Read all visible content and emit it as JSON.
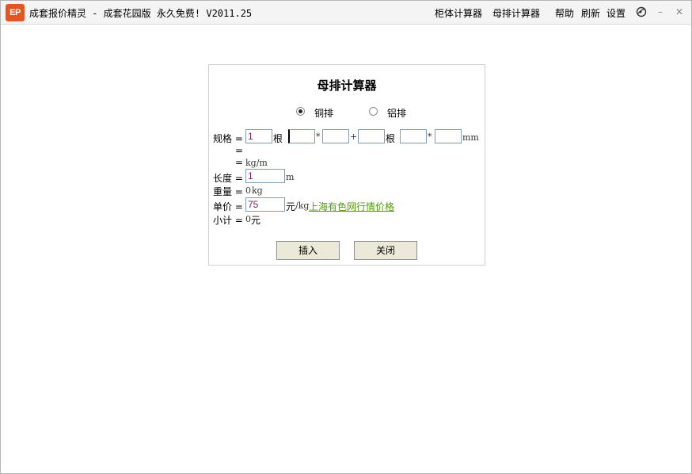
{
  "app": {
    "logo_text": "EP",
    "title": "成套报价精灵 - 成套花园版 永久免费! V2011.25"
  },
  "menu": {
    "cabinet_calc": "柜体计算器",
    "busbar_calc": "母排计算器",
    "help": "帮助",
    "refresh": "刷新",
    "settings": "设置"
  },
  "window_controls": {
    "minimize": "–",
    "close": "✕",
    "skin_icon": "skin-icon"
  },
  "panel": {
    "title": "母排计算器",
    "material": {
      "copper_label": "铜排",
      "aluminum_label": "铝排",
      "selected": "copper"
    },
    "spec": {
      "label": "规格 =",
      "count_value": "1",
      "count_unit": "根",
      "width_value": "",
      "times1": "*",
      "thickness_value": "",
      "plus": "+",
      "count2_value": "",
      "count2_unit": "根",
      "width2_value": "",
      "times2": "*",
      "thickness2_value": "",
      "unit": "mm"
    },
    "eq_line": "=",
    "density": {
      "label": "=",
      "unit": "kg/m"
    },
    "length": {
      "label": "长度 =",
      "value": "1",
      "unit": "m"
    },
    "weight": {
      "label": "重量 =",
      "value": "0",
      "unit": "kg"
    },
    "unit_price": {
      "label": "单价 =",
      "value": "75",
      "unit_yuan": "元",
      "unit_kg": "/kg",
      "link": "上海有色网行情价格"
    },
    "subtotal": {
      "label": "小计 =",
      "value": "0",
      "unit": "元"
    },
    "buttons": {
      "insert": "插入",
      "close": "关闭"
    }
  }
}
